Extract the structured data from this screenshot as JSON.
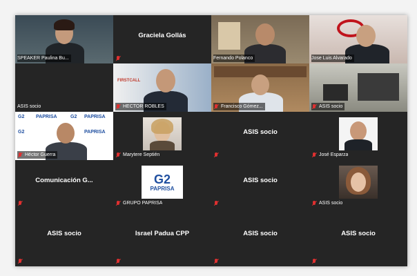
{
  "meeting": {
    "participants": [
      {
        "label": "SPEAKER Paulina Bu...",
        "muted": false,
        "video": true
      },
      {
        "center": "Graciela Gollás",
        "muted": true,
        "video": false
      },
      {
        "label": "Fernando Polanco",
        "muted": false,
        "video": true,
        "active_speaker": true
      },
      {
        "label": "Jose Luis Alvarado",
        "muted": false,
        "video": true
      },
      {
        "label": "ASIS socio",
        "muted": false,
        "video": false
      },
      {
        "label": "HECTOR ROBLES",
        "muted": true,
        "video": true
      },
      {
        "label": "Francisco Gómez...",
        "muted": true,
        "video": true
      },
      {
        "label": "ASIS socio",
        "muted": true,
        "video": true
      },
      {
        "label": "Héctor Guerra",
        "muted": true,
        "video": true
      },
      {
        "label": "Marytere Septién",
        "muted": true,
        "video": true
      },
      {
        "center": "ASIS socio",
        "muted": true,
        "video": false
      },
      {
        "label": "José Esparza",
        "muted": true,
        "video": true
      },
      {
        "center": "Comunicación G...",
        "muted": true,
        "video": false
      },
      {
        "label": "GRUPO PAPRISA",
        "muted": true,
        "video": true
      },
      {
        "center": "ASIS socio",
        "muted": true,
        "video": false
      },
      {
        "label": "ASIS socio",
        "muted": true,
        "video": true
      },
      {
        "center": "ASIS socio",
        "muted": true,
        "video": false
      },
      {
        "center": "Israel Padua CPP",
        "muted": true,
        "video": false
      },
      {
        "center": "ASIS socio",
        "muted": true,
        "video": false
      },
      {
        "center": "ASIS socio",
        "muted": true,
        "video": false
      }
    ],
    "logos": {
      "paprisa_mark": "G2",
      "paprisa_text": "PAPRISA",
      "firstcall_text": "FIRSTCALL"
    },
    "colors": {
      "active_speaker_border": "#c8d400",
      "mute_icon": "#e03030",
      "tile_bg": "#252525"
    }
  }
}
